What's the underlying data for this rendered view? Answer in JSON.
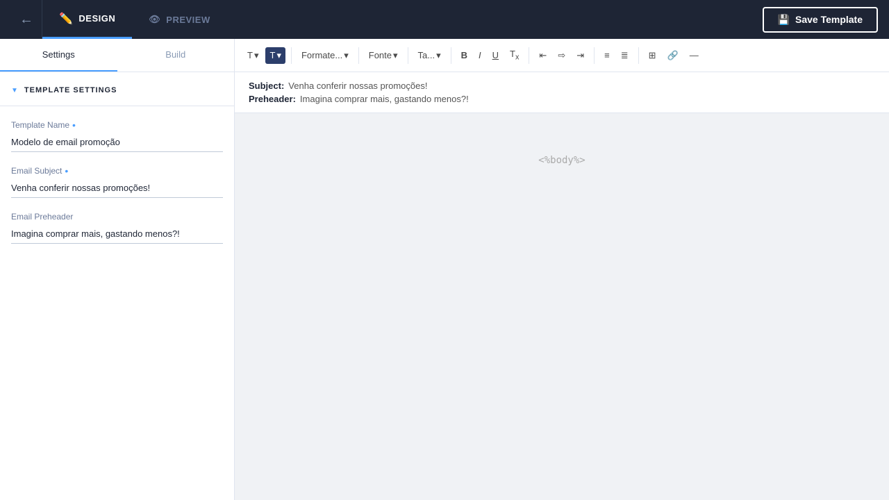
{
  "topnav": {
    "design_label": "DESIGN",
    "preview_label": "PREVIEW",
    "save_label": "Save Template"
  },
  "sidebar": {
    "tabs": [
      {
        "id": "settings",
        "label": "Settings",
        "active": true
      },
      {
        "id": "build",
        "label": "Build",
        "active": false
      }
    ],
    "template_settings": {
      "section_label": "TEMPLATE SETTINGS",
      "fields": [
        {
          "id": "template-name",
          "label": "Template Name",
          "required": true,
          "value": "Modelo de email promoção"
        },
        {
          "id": "email-subject",
          "label": "Email Subject",
          "required": true,
          "value": "Venha conferir nossas promoções!"
        },
        {
          "id": "email-preheader",
          "label": "Email Preheader",
          "required": false,
          "value": "Imagina comprar mais, gastando menos?!"
        }
      ]
    }
  },
  "toolbar": {
    "t_button": "T",
    "t_active_label": "T",
    "format_label": "Formate...",
    "font_label": "Fonte",
    "size_label": "Ta...",
    "bold": "B",
    "italic": "I",
    "underline": "U",
    "strikethrough": "Tx",
    "align_left": "≡",
    "align_center": "≡",
    "align_right": "≡",
    "list_ul": "≡",
    "list_ol": "≡",
    "grid_icon": "⊞",
    "link_icon": "🔗",
    "minus_icon": "—"
  },
  "email_preview": {
    "subject_label": "Subject:",
    "subject_value": "Venha conferir nossas promoções!",
    "preheader_label": "Preheader:",
    "preheader_value": "Imagina comprar mais, gastando menos?!"
  },
  "canvas": {
    "body_placeholder": "<%body%>"
  }
}
